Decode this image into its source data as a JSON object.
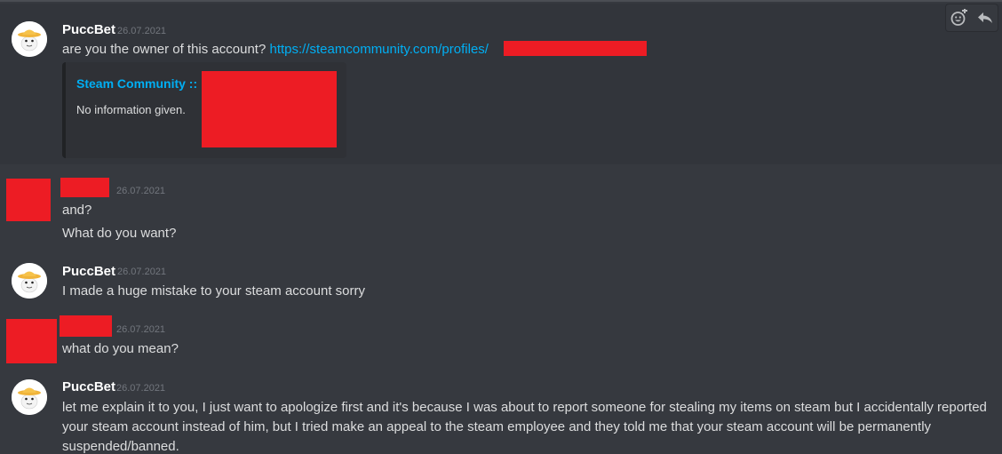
{
  "messages": [
    {
      "author": "PuccBet",
      "timestamp": "26.07.2021",
      "lines": [
        "are you the owner of this account?"
      ],
      "link": "https://steamcommunity.com/profiles/",
      "embed": {
        "title": "Steam Community ::",
        "description": "No information given."
      }
    },
    {
      "author": "",
      "timestamp": "26.07.2021",
      "lines": [
        "and?",
        "What do you want?"
      ]
    },
    {
      "author": "PuccBet",
      "timestamp": "26.07.2021",
      "lines": [
        "I made a huge mistake to your steam account sorry"
      ]
    },
    {
      "author": "",
      "timestamp": "26.07.2021",
      "lines": [
        "what do you mean?"
      ]
    },
    {
      "author": "PuccBet",
      "timestamp": "26.07.2021",
      "lines": [
        "let me explain it to you, I just want to apologize first and it's because I was about to report someone for stealing my items on steam but I accidentally reported",
        "your steam account instead of him, but I tried make an appeal to the steam employee and they told me that your steam account will be permanently",
        "suspended/banned."
      ]
    }
  ],
  "toolbar": {
    "icons": [
      "add-reaction-icon",
      "reply-icon"
    ]
  },
  "colors": {
    "background": "#36393f",
    "hover_background": "#32353b",
    "link": "#00aff4",
    "redaction": "#ed1c24",
    "username": "#ffffff",
    "timestamp": "#72767d",
    "text": "#dcddde",
    "embed_bg": "#2f3136"
  }
}
